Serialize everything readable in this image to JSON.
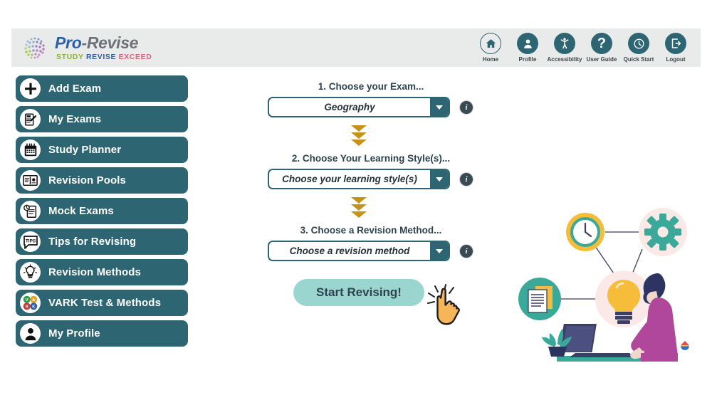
{
  "header": {
    "logo": {
      "main_pro": "Pro",
      "main_dash": "-",
      "main_revise": "Revise",
      "sub_study": "STUDY",
      "sub_revise": "REVISE",
      "sub_exceed": "EXCEED",
      "globe_icon": "globe-dots-icon"
    },
    "nav": [
      {
        "label": "Home",
        "icon": "home-icon"
      },
      {
        "label": "Profile",
        "icon": "person-icon"
      },
      {
        "label": "Accessibility",
        "icon": "accessibility-person-icon"
      },
      {
        "label": "User Guide",
        "icon": "question-mark-icon"
      },
      {
        "label": "Quick Start",
        "icon": "clock-icon"
      },
      {
        "label": "Logout",
        "icon": "logout-arrow-icon"
      }
    ]
  },
  "sidebar": {
    "items": [
      {
        "label": "Add Exam",
        "icon": "plus-circle-icon"
      },
      {
        "label": "My Exams",
        "icon": "exam-paper-pencil-icon"
      },
      {
        "label": "Study Planner",
        "icon": "calendar-icon"
      },
      {
        "label": "Revision Pools",
        "icon": "open-book-icon"
      },
      {
        "label": "Mock Exams",
        "icon": "document-clock-icon"
      },
      {
        "label": "Tips for Revising",
        "icon": "tips-speech-bubble-icon"
      },
      {
        "label": "Revision Methods",
        "icon": "lightbulb-icon"
      },
      {
        "label": "VARK Test & Methods",
        "icon": "vark-four-circles-icon"
      },
      {
        "label": "My Profile",
        "icon": "person-silhouette-icon"
      }
    ]
  },
  "form": {
    "steps": [
      {
        "title": "1. Choose your Exam...",
        "value": "Geography",
        "info_label": "i",
        "dropdown_icon": "chevron-down-icon",
        "info_icon": "info-icon"
      },
      {
        "title": "2. Choose Your Learning Style(s)...",
        "value": "Choose your learning style(s)",
        "info_label": "i",
        "dropdown_icon": "chevron-down-icon",
        "info_icon": "info-icon"
      },
      {
        "title": "3. Choose a Revision Method...",
        "value": "Choose a revision method",
        "info_label": "i",
        "dropdown_icon": "chevron-down-icon",
        "info_icon": "info-icon"
      }
    ],
    "divider_icon": "triple-chevron-down-icon",
    "start_button": "Start Revising!",
    "cursor_icon": "pointing-hand-cursor-icon"
  },
  "illustration": {
    "name": "study-workflow-illustration",
    "elements": [
      "clock-icon",
      "gear-icon",
      "documents-icon",
      "lightbulb-icon",
      "person-at-laptop",
      "plant",
      "badge-logo"
    ]
  },
  "colors": {
    "teal": "#2d6672",
    "mint": "#9ad6cf",
    "gold": "#c69219",
    "header_bg": "#e9eaea",
    "accent_blue": "#2b5fa8",
    "accent_green": "#8ab234",
    "accent_pink": "#e0607e"
  }
}
